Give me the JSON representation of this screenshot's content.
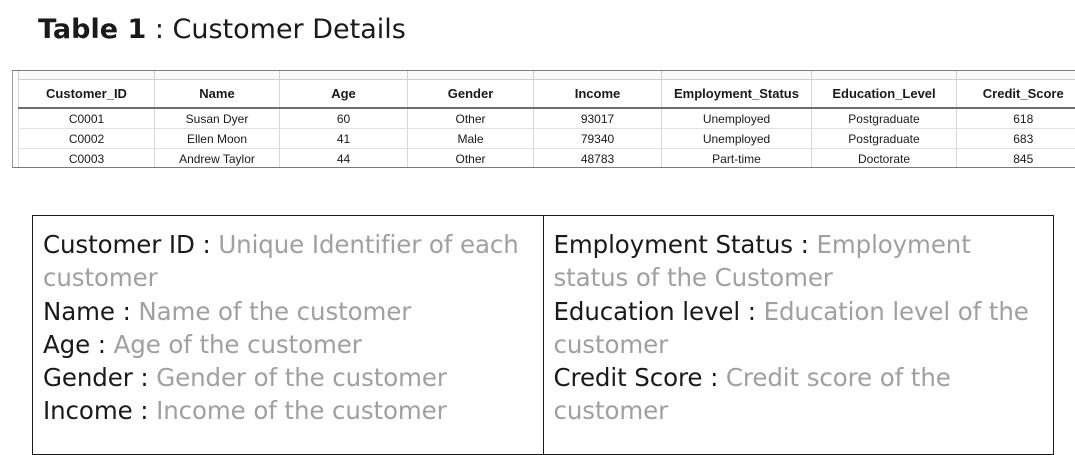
{
  "title": {
    "bold": "Table 1",
    "rest": " : Customer Details"
  },
  "table": {
    "columns": [
      "Customer_ID",
      "Name",
      "Age",
      "Gender",
      "Income",
      "Employment_Status",
      "Education_Level",
      "Credit_Score"
    ],
    "rows": [
      [
        "C0001",
        "Susan Dyer",
        "60",
        "Other",
        "93017",
        "Unemployed",
        "Postgraduate",
        "618"
      ],
      [
        "C0002",
        "Ellen Moon",
        "41",
        "Male",
        "79340",
        "Unemployed",
        "Postgraduate",
        "683"
      ],
      [
        "C0003",
        "Andrew Taylor",
        "44",
        "Other",
        "48783",
        "Part-time",
        "Doctorate",
        "845"
      ]
    ]
  },
  "definitions": {
    "left": [
      {
        "term": "Customer ID",
        "desc": "Unique Identifier of each customer"
      },
      {
        "term": "Name",
        "desc": "Name of the customer"
      },
      {
        "term": "Age",
        "desc": "Age of the customer"
      },
      {
        "term": "Gender",
        "desc": "Gender of the customer"
      },
      {
        "term": "Income",
        "desc": "Income of the customer"
      }
    ],
    "right": [
      {
        "term": "Employment Status",
        "desc": "Employment status of the Customer"
      },
      {
        "term": "Education level",
        "desc": "Education level of the customer"
      },
      {
        "term": "Credit Score",
        "desc": "Credit score of the customer"
      }
    ]
  }
}
